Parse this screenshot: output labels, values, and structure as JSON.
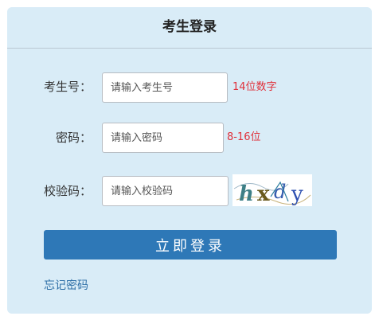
{
  "panel": {
    "title": "考生登录"
  },
  "form": {
    "exam_id": {
      "label": "考生号：",
      "placeholder": "请输入考生号",
      "hint": "14位数字"
    },
    "password": {
      "label": "密码：",
      "placeholder": "请输入密码",
      "hint": "8-16位"
    },
    "captcha": {
      "label": "校验码：",
      "placeholder": "请输入校验码",
      "image_text": "hxdy"
    }
  },
  "actions": {
    "login_label": "立即登录",
    "forgot_label": "忘记密码"
  },
  "colors": {
    "panel_bg": "#d9ecf7",
    "button_bg": "#2e78b7",
    "hint_red": "#e0303a",
    "link_blue": "#2e6fa7"
  }
}
